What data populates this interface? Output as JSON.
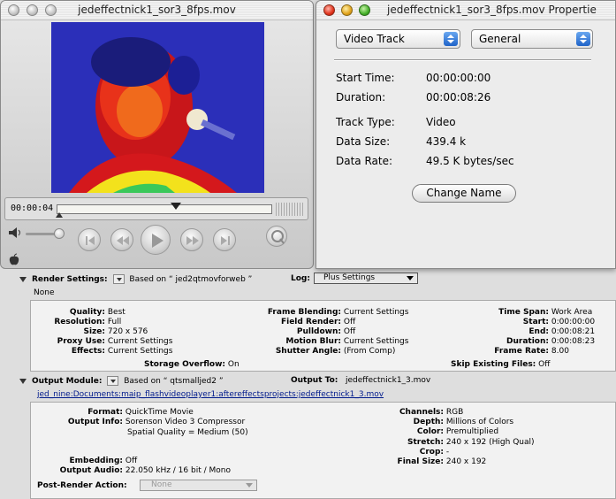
{
  "movie_window": {
    "title": "jedeffectnick1_sor3_8fps.mov",
    "timecode": "00:00:04",
    "playhead_fraction": 0.55
  },
  "properties_window": {
    "title": "jedeffectnick1_sor3_8fps.mov Propertie",
    "track_popup": "Video Track",
    "category_popup": "General",
    "rows": [
      {
        "label": "Start Time:",
        "value": "00:00:00:00"
      },
      {
        "label": "Duration:",
        "value": "00:00:08:26"
      },
      {
        "label": "Track Type:",
        "value": "Video"
      },
      {
        "label": "Data Size:",
        "value": "439.4 k"
      },
      {
        "label": "Data Rate:",
        "value": "49.5 K bytes/sec"
      }
    ],
    "change_name_button": "Change Name"
  },
  "render_queue": {
    "render_settings_label": "Render Settings:",
    "render_settings_based": "Based on “ jed2qtmovforweb ”",
    "log_label": "Log:",
    "log_value": "Plus Settings",
    "none_text": "None",
    "render": {
      "col1": [
        {
          "k": "Quality:",
          "v": "Best"
        },
        {
          "k": "Resolution:",
          "v": "Full"
        },
        {
          "k": "Size:",
          "v": "720 x 576"
        },
        {
          "k": "Proxy Use:",
          "v": "Current Settings"
        },
        {
          "k": "Effects:",
          "v": "Current Settings"
        }
      ],
      "col2": [
        {
          "k": "Frame Blending:",
          "v": "Current Settings"
        },
        {
          "k": "Field Render:",
          "v": "Off"
        },
        {
          "k": "Pulldown:",
          "v": "Off"
        },
        {
          "k": "Motion Blur:",
          "v": "Current Settings"
        },
        {
          "k": "Shutter Angle:",
          "v": "(From Comp)"
        }
      ],
      "col3": [
        {
          "k": "Time Span:",
          "v": "Work Area"
        },
        {
          "k": "Start:",
          "v": "0:00:00:00"
        },
        {
          "k": "End:",
          "v": "0:00:08:21"
        },
        {
          "k": "Duration:",
          "v": "0:00:08:23"
        },
        {
          "k": "Frame Rate:",
          "v": "8.00"
        }
      ],
      "storage_overflow": {
        "k": "Storage Overflow:",
        "v": "On"
      },
      "skip_existing": {
        "k": "Skip Existing Files:",
        "v": "Off"
      }
    },
    "output_module_label": "Output Module:",
    "output_module_based": "Based on “ qtsmalljed2 ”",
    "output_to_label": "Output To:",
    "output_to_value": "jedeffectnick1_3.mov",
    "output_path": "jed_nine:Documents:maip_flashvideoplayer1:aftereffectsprojects:jedeffectnick1_3.mov",
    "output": {
      "format": {
        "k": "Format:",
        "v": "QuickTime Movie"
      },
      "output_info": {
        "k": "Output Info:",
        "v1": "Sorenson Video 3 Compressor",
        "v2": "Spatial Quality = Medium (50)"
      },
      "embedding": {
        "k": "Embedding:",
        "v": "Off"
      },
      "output_audio": {
        "k": "Output Audio:",
        "v": "22.050 kHz / 16 bit / Mono"
      },
      "right": [
        {
          "k": "Channels:",
          "v": "RGB"
        },
        {
          "k": "Depth:",
          "v": "Millions of Colors"
        },
        {
          "k": "Color:",
          "v": "Premultiplied"
        },
        {
          "k": "Stretch:",
          "v": "240 x 192 (High Qual)"
        },
        {
          "k": "Crop:",
          "v": "-"
        },
        {
          "k": "Final Size:",
          "v": "240 x 192"
        }
      ]
    },
    "post_render_label": "Post-Render Action:",
    "post_render_value": "None"
  }
}
